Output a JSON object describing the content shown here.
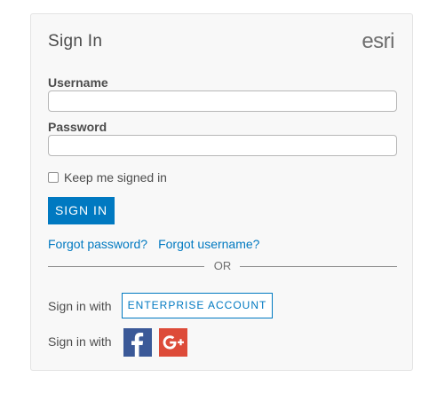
{
  "header": {
    "title": "Sign In",
    "logo_text": "esri"
  },
  "form": {
    "username_label": "Username",
    "username_value": "",
    "password_label": "Password",
    "password_value": "",
    "keep_signed_in_label": "Keep me signed in",
    "keep_signed_in_checked": false,
    "sign_in_button": "SIGN IN"
  },
  "links": {
    "forgot_password": "Forgot password?",
    "forgot_username": "Forgot username?"
  },
  "divider": {
    "text": "OR"
  },
  "alt_signin": {
    "enterprise_label": "Sign in with",
    "enterprise_button": "ENTERPRISE ACCOUNT",
    "social_label": "Sign in with",
    "facebook_icon": "facebook-icon",
    "google_plus_icon": "google-plus-icon"
  },
  "colors": {
    "accent": "#0079c1",
    "facebook": "#3b5998",
    "google_plus": "#dd4b39"
  }
}
